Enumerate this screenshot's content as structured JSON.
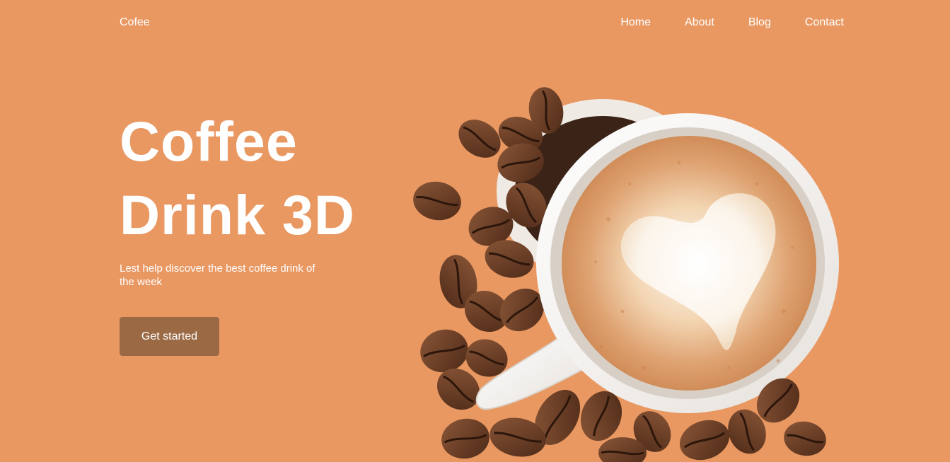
{
  "nav": {
    "brand": "Cofee",
    "links": [
      {
        "label": "Home"
      },
      {
        "label": "About"
      },
      {
        "label": "Blog"
      },
      {
        "label": "Contact"
      }
    ]
  },
  "hero": {
    "title_line1": "Coffee",
    "title_line2": "Drink 3D",
    "subtitle": "Lest help discover the best coffee drink of the week",
    "cta_label": "Get started"
  },
  "colors": {
    "background": "#e99862",
    "button": "#9b6a45",
    "text": "#ffffff"
  },
  "image": {
    "subject": "cappuccino-cup-with-coffee-beans"
  }
}
